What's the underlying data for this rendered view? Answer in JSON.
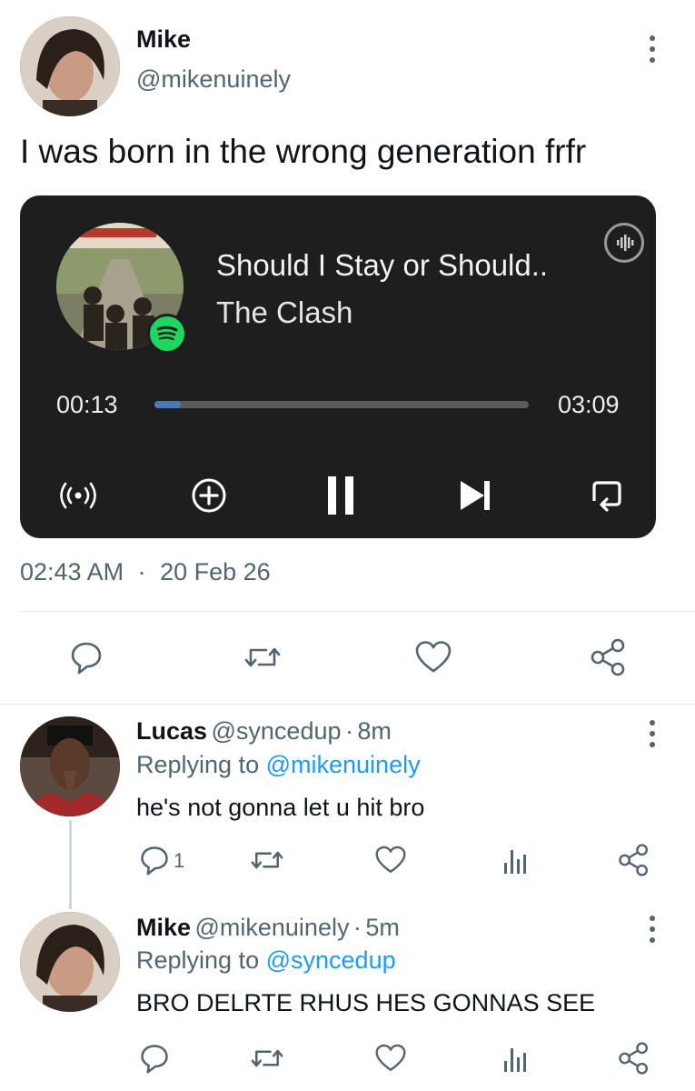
{
  "tweet": {
    "author_name": "Mike",
    "author_handle": "@mikenuinely",
    "text": "I was born in the wrong generation frfr",
    "timestamp": "02:43 AM",
    "separator": "·",
    "date": "20 Feb 26"
  },
  "player": {
    "song_title": "Should I Stay or Should..",
    "artist": "The Clash",
    "elapsed": "00:13",
    "duration": "03:09",
    "progress": 0.07,
    "accent": "#1ed760",
    "icons": [
      "broadcast-icon",
      "add-icon",
      "pause-icon",
      "skip-next-icon",
      "repeat-icon"
    ]
  },
  "replies": [
    {
      "name": "Lucas",
      "handle": "@syncedup",
      "sep": "·",
      "time": "8m",
      "replying_label": "Replying to",
      "replying_to": "@mikenuinely",
      "text": "he's not gonna let u hit bro",
      "reply_count": "1"
    },
    {
      "name": "Mike",
      "handle": "@mikenuinely",
      "sep": "·",
      "time": "5m",
      "replying_label": "Replying to",
      "replying_to": "@syncedup",
      "text": "BRO DELRTE RHUS HES GONNAS SEE",
      "reply_count": ""
    }
  ],
  "colors": {
    "link": "#1d9bf0",
    "muted": "#536471",
    "card_bg": "#1e1e1e"
  }
}
